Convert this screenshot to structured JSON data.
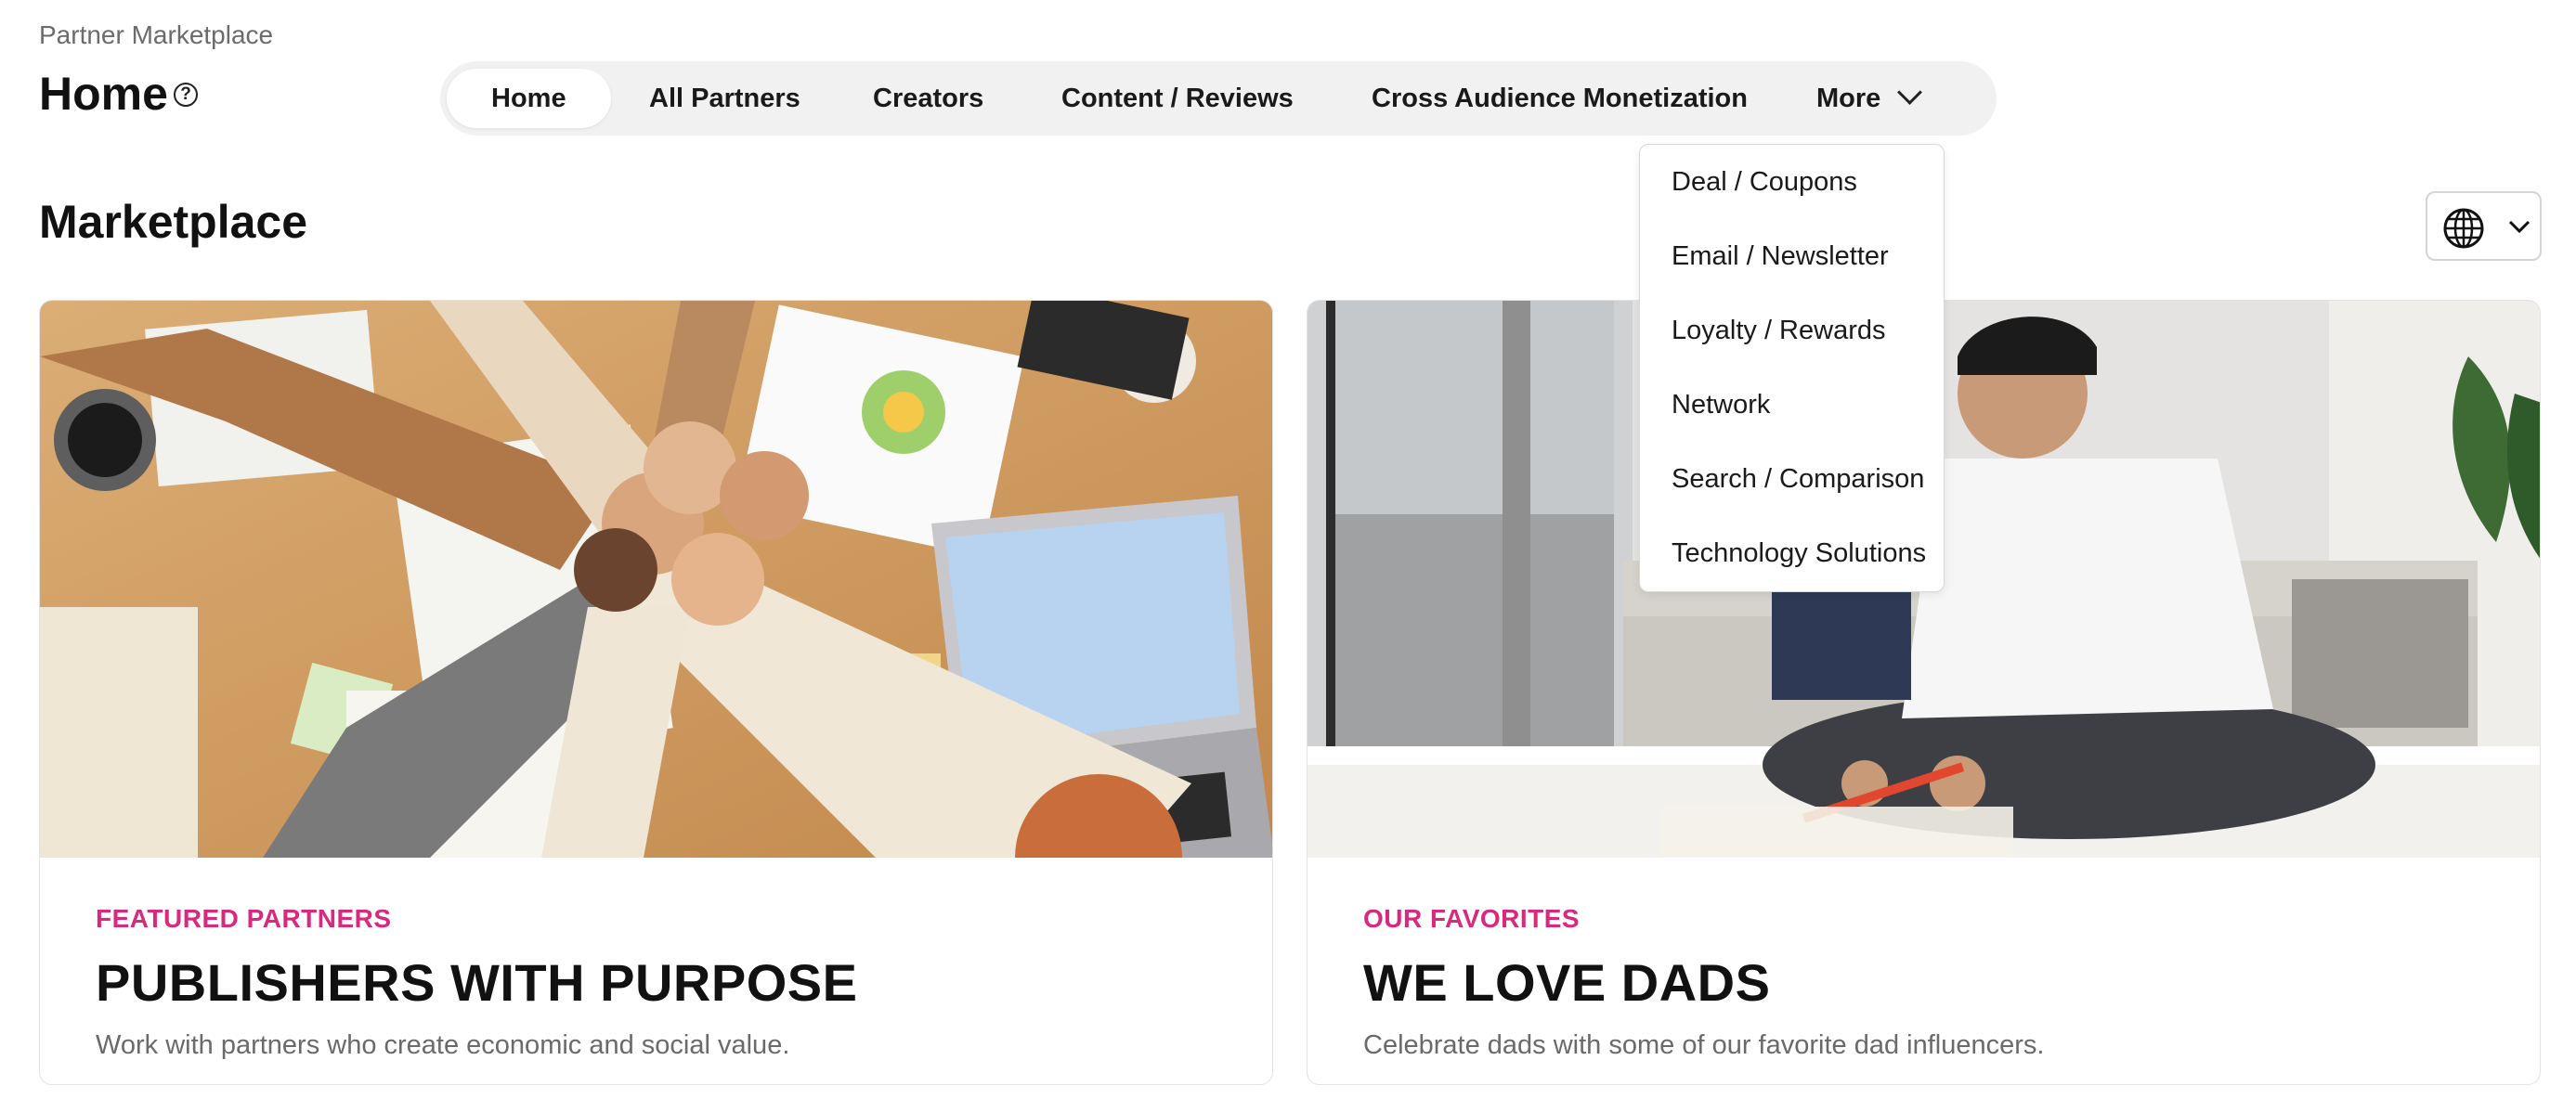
{
  "breadcrumb": "Partner Marketplace",
  "page_title": "Home",
  "help_icon": "?",
  "nav": {
    "tabs": [
      {
        "label": "Home",
        "active": true
      },
      {
        "label": "All Partners"
      },
      {
        "label": "Creators"
      },
      {
        "label": "Content / Reviews"
      },
      {
        "label": "Cross Audience Monetization"
      }
    ],
    "more_label": "More"
  },
  "more_menu": [
    "Deal / Coupons",
    "Email / Newsletter",
    "Loyalty / Rewards",
    "Network",
    "Search / Comparison",
    "Technology Solutions"
  ],
  "section_title": "Marketplace",
  "language_selector": {
    "icon": "globe-icon"
  },
  "cards": [
    {
      "eyebrow": "FEATURED PARTNERS",
      "headline": "PUBLISHERS WITH PURPOSE",
      "description": "Work with partners who create economic and social value.",
      "image": "team-fist-bump-photo"
    },
    {
      "eyebrow": "OUR FAVORITES",
      "headline": "WE LOVE DADS",
      "description": "Celebrate dads with some of our favorite dad influencers.",
      "image": "dad-and-child-drawing-photo"
    }
  ],
  "colors": {
    "accent": "#d9297d",
    "tabbar": "#f1f1f1"
  }
}
